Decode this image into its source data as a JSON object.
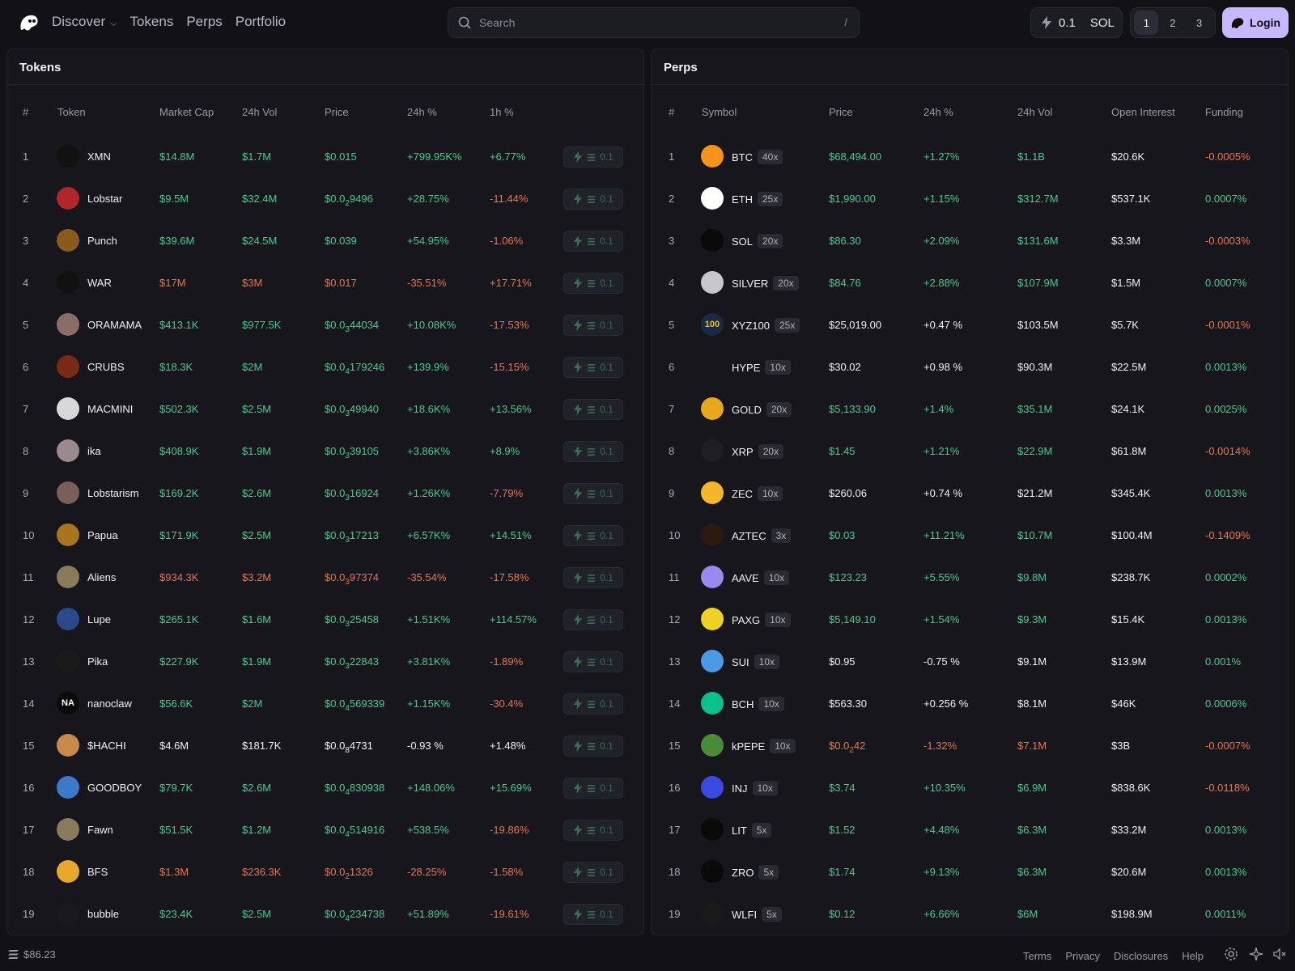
{
  "nav": {
    "discover": "Discover",
    "tokens": "Tokens",
    "perps": "Perps",
    "portfolio": "Portfolio"
  },
  "search": {
    "placeholder": "Search",
    "shortcut": "/"
  },
  "buy": {
    "amount": "0.1",
    "currency": "SOL"
  },
  "presets": [
    "1",
    "2",
    "3"
  ],
  "login": "Login",
  "tokens_panel": {
    "title": "Tokens",
    "headers": {
      "idx": "#",
      "token": "Token",
      "mcap": "Market Cap",
      "vol": "24h Vol",
      "price": "Price",
      "ch24": "24h %",
      "ch1": "1h %"
    },
    "quick_amount": "0.1",
    "rows": [
      {
        "i": "1",
        "name": "XMN",
        "mcap": "$14.8M",
        "vol": "$1.7M",
        "price": "$0.015",
        "ch24": "+799.95K%",
        "ch1": "+6.77%",
        "mc": "g",
        "vc": "g",
        "pc": "g",
        "c24": "g",
        "c1": "g",
        "av": "#111"
      },
      {
        "i": "2",
        "name": "Lobstar",
        "mcap": "$9.5M",
        "vol": "$32.4M",
        "p0": "$0.0",
        "psub": "2",
        "p1": "9496",
        "ch24": "+28.75%",
        "ch1": "-11.44%",
        "mc": "g",
        "vc": "g",
        "pc": "g",
        "c24": "g",
        "c1": "r",
        "av": "#b0262a"
      },
      {
        "i": "3",
        "name": "Punch",
        "mcap": "$39.6M",
        "vol": "$24.5M",
        "price": "$0.039",
        "ch24": "+54.95%",
        "ch1": "-1.06%",
        "mc": "g",
        "vc": "g",
        "pc": "g",
        "c24": "g",
        "c1": "r",
        "av": "#8a5a1c"
      },
      {
        "i": "4",
        "name": "WAR",
        "mcap": "$17M",
        "vol": "$3M",
        "price": "$0.017",
        "ch24": "-35.51%",
        "ch1": "+17.71%",
        "mc": "r",
        "vc": "r",
        "pc": "r",
        "c24": "r",
        "c1": "r",
        "av": "#111"
      },
      {
        "i": "5",
        "name": "ORAMAMA",
        "mcap": "$413.1K",
        "vol": "$977.5K",
        "p0": "$0.0",
        "psub": "3",
        "p1": "44034",
        "ch24": "+10.08K%",
        "ch1": "-17.53%",
        "mc": "g",
        "vc": "g",
        "pc": "g",
        "c24": "g",
        "c1": "r",
        "av": "#8a6e66"
      },
      {
        "i": "6",
        "name": "CRUBS",
        "mcap": "$18.3K",
        "vol": "$2M",
        "p0": "$0.0",
        "psub": "4",
        "p1": "179246",
        "ch24": "+139.9%",
        "ch1": "-15.15%",
        "mc": "g",
        "vc": "g",
        "pc": "g",
        "c24": "g",
        "c1": "r",
        "av": "#7a2a14"
      },
      {
        "i": "7",
        "name": "MACMINI",
        "mcap": "$502.3K",
        "vol": "$2.5M",
        "p0": "$0.0",
        "psub": "3",
        "p1": "49940",
        "ch24": "+18.6K%",
        "ch1": "+13.56%",
        "mc": "g",
        "vc": "g",
        "pc": "g",
        "c24": "g",
        "c1": "g",
        "av": "#d8d8d8"
      },
      {
        "i": "8",
        "name": "ika",
        "mcap": "$408.9K",
        "vol": "$1.9M",
        "p0": "$0.0",
        "psub": "3",
        "p1": "39105",
        "ch24": "+3.86K%",
        "ch1": "+8.9%",
        "mc": "g",
        "vc": "g",
        "pc": "g",
        "c24": "g",
        "c1": "g",
        "av": "#9a8a8e"
      },
      {
        "i": "9",
        "name": "Lobstarism",
        "mcap": "$169.2K",
        "vol": "$2.6M",
        "p0": "$0.0",
        "psub": "3",
        "p1": "16924",
        "ch24": "+1.26K%",
        "ch1": "-7.79%",
        "mc": "g",
        "vc": "g",
        "pc": "g",
        "c24": "g",
        "c1": "r",
        "av": "#7a5e5a"
      },
      {
        "i": "10",
        "name": "Papua",
        "mcap": "$171.9K",
        "vol": "$2.5M",
        "p0": "$0.0",
        "psub": "3",
        "p1": "17213",
        "ch24": "+6.57K%",
        "ch1": "+14.51%",
        "mc": "g",
        "vc": "g",
        "pc": "g",
        "c24": "g",
        "c1": "g",
        "av": "#a8741c"
      },
      {
        "i": "11",
        "name": "Aliens",
        "mcap": "$934.3K",
        "vol": "$3.2M",
        "p0": "$0.0",
        "psub": "3",
        "p1": "97374",
        "ch24": "-35.54%",
        "ch1": "-17.58%",
        "mc": "r",
        "vc": "r",
        "pc": "r",
        "c24": "r",
        "c1": "r",
        "av": "#8a7a5a"
      },
      {
        "i": "12",
        "name": "Lupe",
        "mcap": "$265.1K",
        "vol": "$1.6M",
        "p0": "$0.0",
        "psub": "3",
        "p1": "25458",
        "ch24": "+1.51K%",
        "ch1": "+114.57%",
        "mc": "g",
        "vc": "g",
        "pc": "g",
        "c24": "g",
        "c1": "g",
        "av": "#2a4a8a"
      },
      {
        "i": "13",
        "name": "Pika",
        "mcap": "$227.9K",
        "vol": "$1.9M",
        "p0": "$0.0",
        "psub": "3",
        "p1": "22843",
        "ch24": "+3.81K%",
        "ch1": "-1.89%",
        "mc": "g",
        "vc": "g",
        "pc": "g",
        "c24": "g",
        "c1": "r",
        "av": "#1a1a1a"
      },
      {
        "i": "14",
        "name": "nanoclaw",
        "mcap": "$56.6K",
        "vol": "$2M",
        "p0": "$0.0",
        "psub": "4",
        "p1": "569339",
        "ch24": "+1.15K%",
        "ch1": "-30.4%",
        "mc": "g",
        "vc": "g",
        "pc": "g",
        "c24": "g",
        "c1": "r",
        "av": "#0a0a0a",
        "avtext": "NA"
      },
      {
        "i": "15",
        "name": "$HACHI",
        "mcap": "$4.6M",
        "vol": "$181.7K",
        "p0": "$0.0",
        "psub": "8",
        "p1": "4731",
        "ch24": "-0.93 %",
        "ch1": "+1.48%",
        "mc": "w",
        "vc": "w",
        "pc": "w",
        "c24": "w",
        "c1": "w",
        "av": "#c88a4a"
      },
      {
        "i": "16",
        "name": "GOODBOY",
        "mcap": "$79.7K",
        "vol": "$2.6M",
        "p0": "$0.0",
        "psub": "4",
        "p1": "830938",
        "ch24": "+148.06%",
        "ch1": "+15.69%",
        "mc": "g",
        "vc": "g",
        "pc": "g",
        "c24": "g",
        "c1": "g",
        "av": "#3a7ac8"
      },
      {
        "i": "17",
        "name": "Fawn",
        "mcap": "$51.5K",
        "vol": "$1.2M",
        "p0": "$0.0",
        "psub": "4",
        "p1": "514916",
        "ch24": "+538.5%",
        "ch1": "-19.86%",
        "mc": "g",
        "vc": "g",
        "pc": "g",
        "c24": "g",
        "c1": "r",
        "av": "#8a7a5e"
      },
      {
        "i": "18",
        "name": "BFS",
        "mcap": "$1.3M",
        "vol": "$236.3K",
        "p0": "$0.0",
        "psub": "2",
        "p1": "1326",
        "ch24": "-28.25%",
        "ch1": "-1.58%",
        "mc": "r",
        "vc": "r",
        "pc": "r",
        "c24": "r",
        "c1": "r",
        "av": "#e8a82a"
      },
      {
        "i": "19",
        "name": "bubble",
        "mcap": "$23.4K",
        "vol": "$2.5M",
        "p0": "$0.0",
        "psub": "4",
        "p1": "234738",
        "ch24": "+51.89%",
        "ch1": "-19.61%",
        "mc": "g",
        "vc": "g",
        "pc": "g",
        "c24": "g",
        "c1": "r",
        "av": "#1a1a1e"
      }
    ]
  },
  "perps_panel": {
    "title": "Perps",
    "headers": {
      "idx": "#",
      "symbol": "Symbol",
      "price": "Price",
      "ch24": "24h %",
      "vol": "24h Vol",
      "oi": "Open Interest",
      "funding": "Funding"
    },
    "rows": [
      {
        "i": "1",
        "sym": "BTC",
        "lev": "40x",
        "price": "$68,494.00",
        "ch24": "+1.27%",
        "vol": "$1.1B",
        "oi": "$20.6K",
        "fund": "-0.0005%",
        "pc": "g",
        "c24": "g",
        "vc": "g",
        "fc": "r",
        "av": "#f7931a"
      },
      {
        "i": "2",
        "sym": "ETH",
        "lev": "25x",
        "price": "$1,990.00",
        "ch24": "+1.15%",
        "vol": "$312.7M",
        "oi": "$537.1K",
        "fund": "0.0007%",
        "pc": "g",
        "c24": "g",
        "vc": "g",
        "fc": "g",
        "av": "#ffffff"
      },
      {
        "i": "3",
        "sym": "SOL",
        "lev": "20x",
        "price": "$86.30",
        "ch24": "+2.09%",
        "vol": "$131.6M",
        "oi": "$3.3M",
        "fund": "-0.0003%",
        "pc": "g",
        "c24": "g",
        "vc": "g",
        "fc": "r",
        "av": "#0a0a0a"
      },
      {
        "i": "4",
        "sym": "SILVER",
        "lev": "20x",
        "price": "$84.76",
        "ch24": "+2.88%",
        "vol": "$107.9M",
        "oi": "$1.5M",
        "fund": "0.0007%",
        "pc": "g",
        "c24": "g",
        "vc": "g",
        "fc": "g",
        "av": "#c8c8cc"
      },
      {
        "i": "5",
        "sym": "XYZ100",
        "lev": "25x",
        "price": "$25,019.00",
        "ch24": "+0.47 %",
        "vol": "$103.5M",
        "oi": "$5.7K",
        "fund": "-0.0001%",
        "pc": "w",
        "c24": "w",
        "vc": "w",
        "fc": "r",
        "av": "#1a2a44",
        "avtext": "100"
      },
      {
        "i": "6",
        "sym": "HYPE",
        "lev": "10x",
        "price": "$30.02",
        "ch24": "+0.98 %",
        "vol": "$90.3M",
        "oi": "$22.5M",
        "fund": "0.0013%",
        "pc": "w",
        "c24": "w",
        "vc": "w",
        "fc": "g",
        "av": "#16161c"
      },
      {
        "i": "7",
        "sym": "GOLD",
        "lev": "20x",
        "price": "$5,133.90",
        "ch24": "+1.4%",
        "vol": "$35.1M",
        "oi": "$24.1K",
        "fund": "0.0025%",
        "pc": "g",
        "c24": "g",
        "vc": "g",
        "fc": "g",
        "av": "#e8a81c"
      },
      {
        "i": "8",
        "sym": "XRP",
        "lev": "20x",
        "price": "$1.45",
        "ch24": "+1.21%",
        "vol": "$22.9M",
        "oi": "$61.8M",
        "fund": "-0.0014%",
        "pc": "g",
        "c24": "g",
        "vc": "g",
        "fc": "r",
        "av": "#1e1e24"
      },
      {
        "i": "9",
        "sym": "ZEC",
        "lev": "10x",
        "price": "$260.06",
        "ch24": "+0.74 %",
        "vol": "$21.2M",
        "oi": "$345.4K",
        "fund": "0.0013%",
        "pc": "w",
        "c24": "w",
        "vc": "w",
        "fc": "g",
        "av": "#f4b728"
      },
      {
        "i": "10",
        "sym": "AZTEC",
        "lev": "3x",
        "price": "$0.03",
        "ch24": "+11.21%",
        "vol": "$10.7M",
        "oi": "$100.4M",
        "fund": "-0.1409%",
        "pc": "g",
        "c24": "g",
        "vc": "g",
        "fc": "r",
        "av": "#2a1a10"
      },
      {
        "i": "11",
        "sym": "AAVE",
        "lev": "10x",
        "price": "$123.23",
        "ch24": "+5.55%",
        "vol": "$9.8M",
        "oi": "$238.7K",
        "fund": "0.0002%",
        "pc": "g",
        "c24": "g",
        "vc": "g",
        "fc": "g",
        "av": "#9a8af0"
      },
      {
        "i": "12",
        "sym": "PAXG",
        "lev": "10x",
        "price": "$5,149.10",
        "ch24": "+1.54%",
        "vol": "$9.3M",
        "oi": "$15.4K",
        "fund": "0.0013%",
        "pc": "g",
        "c24": "g",
        "vc": "g",
        "fc": "g",
        "av": "#f0d020"
      },
      {
        "i": "13",
        "sym": "SUI",
        "lev": "10x",
        "price": "$0.95",
        "ch24": "-0.75 %",
        "vol": "$9.1M",
        "oi": "$13.9M",
        "fund": "0.001%",
        "pc": "w",
        "c24": "w",
        "vc": "w",
        "fc": "g",
        "av": "#4a9ae8"
      },
      {
        "i": "14",
        "sym": "BCH",
        "lev": "10x",
        "price": "$563.30",
        "ch24": "+0.256 %",
        "vol": "$8.1M",
        "oi": "$46K",
        "fund": "0.0006%",
        "pc": "w",
        "c24": "w",
        "vc": "w",
        "fc": "g",
        "av": "#0ac18e"
      },
      {
        "i": "15",
        "sym": "kPEPE",
        "lev": "10x",
        "p0": "$0.0",
        "psub": "2",
        "p1": "42",
        "ch24": "-1.32%",
        "vol": "$7.1M",
        "oi": "$3B",
        "fund": "-0.0007%",
        "pc": "r",
        "c24": "r",
        "vc": "r",
        "fc": "r",
        "av": "#4a8a3a"
      },
      {
        "i": "16",
        "sym": "INJ",
        "lev": "10x",
        "price": "$3.74",
        "ch24": "+10.35%",
        "vol": "$6.9M",
        "oi": "$838.6K",
        "fund": "-0.0118%",
        "pc": "g",
        "c24": "g",
        "vc": "g",
        "fc": "r",
        "av": "#3a4ae0"
      },
      {
        "i": "17",
        "sym": "LIT",
        "lev": "5x",
        "price": "$1.52",
        "ch24": "+4.48%",
        "vol": "$6.3M",
        "oi": "$33.2M",
        "fund": "0.0013%",
        "pc": "g",
        "c24": "g",
        "vc": "g",
        "fc": "g",
        "av": "#0a0a0a"
      },
      {
        "i": "18",
        "sym": "ZRO",
        "lev": "5x",
        "price": "$1.74",
        "ch24": "+9.13%",
        "vol": "$6.3M",
        "oi": "$20.6M",
        "fund": "0.0013%",
        "pc": "g",
        "c24": "g",
        "vc": "g",
        "fc": "g",
        "av": "#0a0a0a"
      },
      {
        "i": "19",
        "sym": "WLFI",
        "lev": "5x",
        "price": "$0.12",
        "ch24": "+6.66%",
        "vol": "$6M",
        "oi": "$198.9M",
        "fund": "0.0011%",
        "pc": "g",
        "c24": "g",
        "vc": "g",
        "fc": "g",
        "av": "#1a1a1a"
      }
    ]
  },
  "footer": {
    "sol_price": "$86.23",
    "links": [
      "Terms",
      "Privacy",
      "Disclosures",
      "Help"
    ]
  },
  "colors": {
    "green": "#3ecf8e",
    "red": "#f0734a",
    "accent": "#c8b8ff"
  }
}
